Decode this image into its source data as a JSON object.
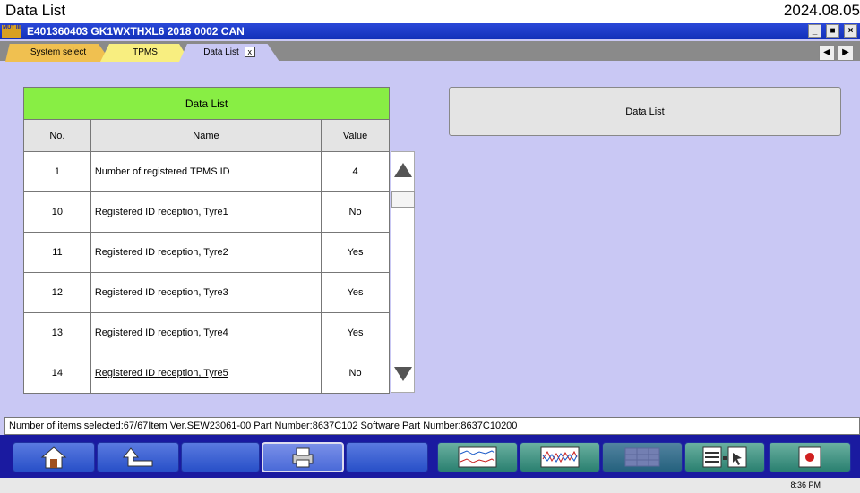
{
  "caption": {
    "left": "Data List",
    "right": "2024.08.05"
  },
  "window": {
    "title": "E401360403   GK1WXTHXL6 2018    0002 CAN",
    "logo_text": "MUT III"
  },
  "tabs": [
    {
      "label": "System select"
    },
    {
      "label": "TPMS"
    },
    {
      "label": "Data List",
      "close": "x"
    }
  ],
  "table": {
    "title": "Data List",
    "columns": [
      "No.",
      "Name",
      "Value"
    ],
    "rows": [
      {
        "no": "1",
        "name": "Number of registered TPMS ID",
        "value": "4"
      },
      {
        "no": "10",
        "name": "Registered ID reception, Tyre1",
        "value": "No"
      },
      {
        "no": "11",
        "name": "Registered ID reception, Tyre2",
        "value": "Yes"
      },
      {
        "no": "12",
        "name": "Registered ID reception, Tyre3",
        "value": "Yes"
      },
      {
        "no": "13",
        "name": "Registered ID reception, Tyre4",
        "value": "Yes"
      },
      {
        "no": "14",
        "name": "Registered ID reception, Tyre5",
        "value": "No"
      }
    ]
  },
  "right_panel": {
    "label": "Data List"
  },
  "status": "Number of items selected:67/67Item   Ver.SEW23061-00 Part Number:8637C102   Software Part Number:8637C10200",
  "toolbar": {
    "buttons": [
      "home-icon",
      "back-up-icon",
      "blank",
      "print-icon",
      "blank",
      "graph-icon",
      "graph-multi-icon",
      "table-icon",
      "list-select-icon",
      "record-icon"
    ]
  },
  "taskbar": {
    "clock": "8:36 PM"
  },
  "colors": {
    "title_bar": "#1a3ac8",
    "tab_active": "#c9c8f4",
    "table_header": "#88ee44",
    "background": "#c9c8f4",
    "toolbar": "#1a1aa0"
  }
}
